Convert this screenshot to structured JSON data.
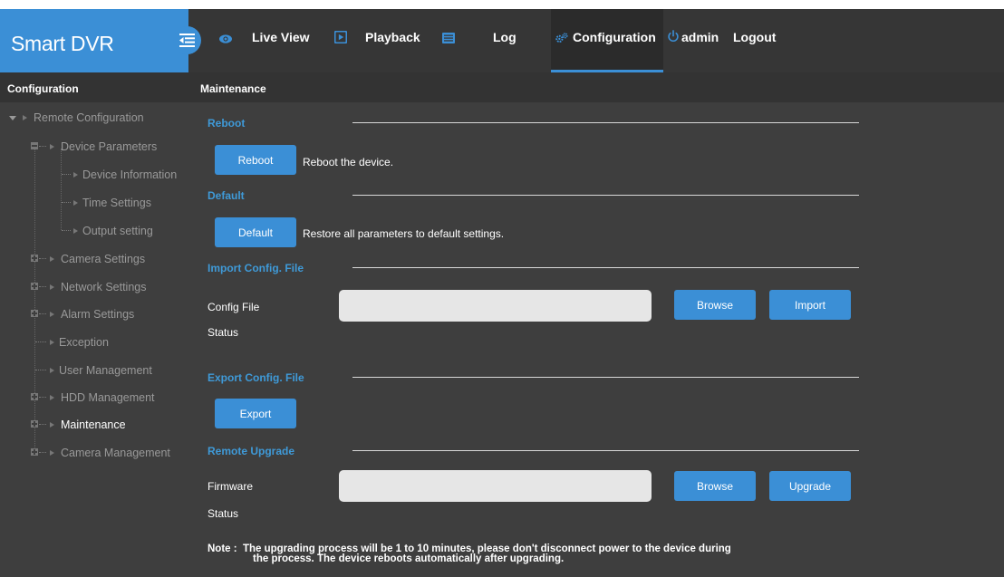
{
  "brand": {
    "title": "Smart DVR"
  },
  "nav": {
    "live_view": "Live View",
    "playback": "Playback",
    "log": "Log",
    "configuration": "Configuration",
    "user": "admin",
    "logout": "Logout",
    "active_item": "configuration"
  },
  "sidebar": {
    "title": "Configuration",
    "items": [
      {
        "label": "Remote Configuration",
        "level": 0,
        "expanded": true
      },
      {
        "label": "Device Parameters",
        "level": 1,
        "expanded": true
      },
      {
        "label": "Device Information",
        "level": 2
      },
      {
        "label": "Time Settings",
        "level": 2
      },
      {
        "label": "Output setting",
        "level": 2
      },
      {
        "label": "Camera Settings",
        "level": 1,
        "expanded": false
      },
      {
        "label": "Network Settings",
        "level": 1,
        "expanded": false
      },
      {
        "label": "Alarm Settings",
        "level": 1,
        "expanded": false
      },
      {
        "label": "Exception",
        "level": 1
      },
      {
        "label": "User Management",
        "level": 1
      },
      {
        "label": "HDD Management",
        "level": 1,
        "expanded": false
      },
      {
        "label": "Maintenance",
        "level": 1,
        "expanded": false,
        "active": true
      },
      {
        "label": "Camera Management",
        "level": 1,
        "expanded": false
      }
    ]
  },
  "main": {
    "title": "Maintenance",
    "reboot": {
      "title": "Reboot",
      "button": "Reboot",
      "description": "Reboot the device."
    },
    "default": {
      "title": "Default",
      "button": "Default",
      "description": "Restore all parameters to default settings."
    },
    "import": {
      "title": "Import Config. File",
      "file_label": "Config File",
      "file_value": "",
      "browse": "Browse",
      "import": "Import",
      "status_label": "Status"
    },
    "export": {
      "title": "Export Config. File",
      "button": "Export"
    },
    "upgrade": {
      "title": "Remote Upgrade",
      "file_label": "Firmware",
      "file_value": "",
      "browse": "Browse",
      "upgrade": "Upgrade",
      "status_label": "Status",
      "note_line1": "Note :  The upgrading process will be 1 to 10 minutes, please don't disconnect power to the device during",
      "note_line2": "the process. The device reboots automatically after upgrading."
    }
  },
  "colors": {
    "accent": "#3b8fd6",
    "section_title": "#3f9ad8",
    "panel": "#3e3e3e",
    "header": "#363636"
  },
  "icons": {
    "live_view": "eye-icon",
    "playback": "play-square-icon",
    "log": "list-icon",
    "configuration": "gears-icon",
    "user": "power-icon",
    "menu": "menu-collapse-icon"
  }
}
